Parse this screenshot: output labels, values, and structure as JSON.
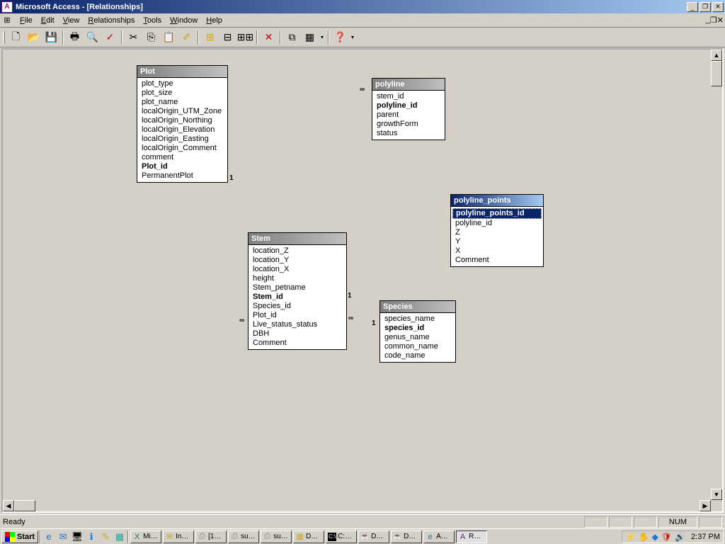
{
  "window": {
    "title": "Microsoft Access - [Relationships]"
  },
  "menu": [
    "File",
    "Edit",
    "View",
    "Relationships",
    "Tools",
    "Window",
    "Help"
  ],
  "tables": {
    "plot": {
      "title": "Plot",
      "fields": [
        "plot_type",
        "plot_size",
        "plot_name",
        "localOrigin_UTM_Zone",
        "localOrigin_Northing",
        "localOrigin_Elevation",
        "localOrigin_Easting",
        "localOrigin_Comment",
        "comment",
        "Plot_id",
        "PermanentPlot"
      ],
      "bold": [
        "Plot_id"
      ]
    },
    "stem": {
      "title": "Stem",
      "fields": [
        "location_Z",
        "location_Y",
        "location_X",
        "height",
        "Stem_petname",
        "Stem_id",
        "Species_id",
        "Plot_id",
        "Live_status_status",
        "DBH",
        "Comment"
      ],
      "bold": [
        "Stem_id"
      ]
    },
    "polyline": {
      "title": "polyline",
      "fields": [
        "stem_id",
        "polyline_id",
        "parent",
        "growthForm",
        "status"
      ],
      "bold": [
        "polyline_id"
      ]
    },
    "polyline_points": {
      "title": "polyline_points",
      "fields": [
        "polyline_points_id",
        "polyline_id",
        "Z",
        "Y",
        "X",
        "Comment"
      ],
      "bold": [
        "polyline_points_id"
      ],
      "selected": "polyline_points_id"
    },
    "species": {
      "title": "Species",
      "fields": [
        "species_name",
        "species_id",
        "genus_name",
        "common_name",
        "code_name"
      ],
      "bold": [
        "species_id"
      ]
    }
  },
  "status": {
    "text": "Ready",
    "num": "NUM"
  },
  "taskbar": {
    "start": "Start",
    "tasks": [
      "Mi…",
      "In…",
      "[1…",
      "su…",
      "su…",
      "D…",
      "C:…",
      "D…",
      "D…",
      "A…",
      "R…"
    ],
    "clock": "2:37 PM"
  },
  "rel_labels": {
    "one": "1",
    "many": "∞"
  }
}
